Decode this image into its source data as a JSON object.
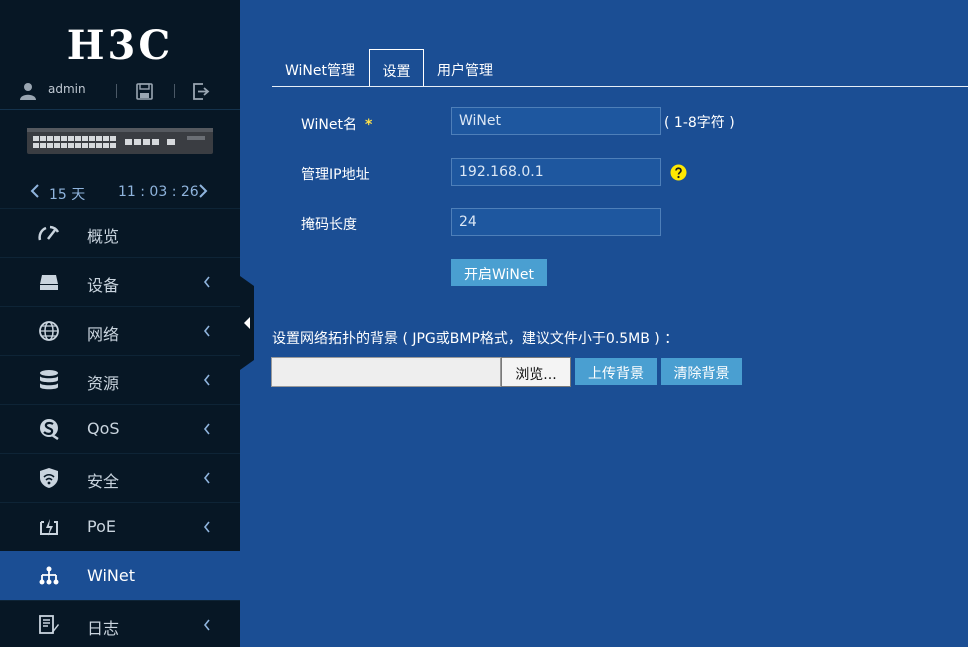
{
  "brand": {
    "logo_text": "H3C"
  },
  "user": {
    "name": "admin"
  },
  "uptime": {
    "days": "15 天",
    "clock": "11 : 03 : 26"
  },
  "nav": {
    "items": [
      {
        "label": "概览",
        "icon": "dashboard-gauge-icon",
        "has_submenu": false
      },
      {
        "label": "设备",
        "icon": "device-icon",
        "has_submenu": true
      },
      {
        "label": "网络",
        "icon": "globe-icon",
        "has_submenu": true
      },
      {
        "label": "资源",
        "icon": "database-icon",
        "has_submenu": true
      },
      {
        "label": "QoS",
        "icon": "qos-icon",
        "has_submenu": true
      },
      {
        "label": "安全",
        "icon": "shield-icon",
        "has_submenu": true
      },
      {
        "label": "PoE",
        "icon": "poe-icon",
        "has_submenu": true
      },
      {
        "label": "WiNet",
        "icon": "network-tree-icon",
        "has_submenu": false,
        "active": true
      },
      {
        "label": "日志",
        "icon": "log-icon",
        "has_submenu": true
      }
    ]
  },
  "tabs": [
    {
      "label": "WiNet管理",
      "active": false
    },
    {
      "label": "设置",
      "active": true
    },
    {
      "label": "用户管理",
      "active": false
    }
  ],
  "form": {
    "winet_name": {
      "label": "WiNet名",
      "required_mark": "*",
      "value": "WiNet",
      "hint": "( 1-8字符 )"
    },
    "mgmt_ip": {
      "label": "管理IP地址",
      "value": "192.168.0.1"
    },
    "mask_len": {
      "label": "掩码长度",
      "value": "24"
    },
    "enable_button": "开启WiNet"
  },
  "background": {
    "label": "设置网络拓扑的背景 ( JPG或BMP格式，建议文件小于0.5MB ) ：",
    "file_value": "",
    "browse_button": "浏览...",
    "upload_button": "上传背景",
    "clear_button": "清除背景"
  },
  "colors": {
    "main_bg": "#1b4e94",
    "sidebar_bg": "#071725",
    "button_bg": "#4a9fd1",
    "required_star": "#ffe24a",
    "help_icon": "#ffe800"
  }
}
